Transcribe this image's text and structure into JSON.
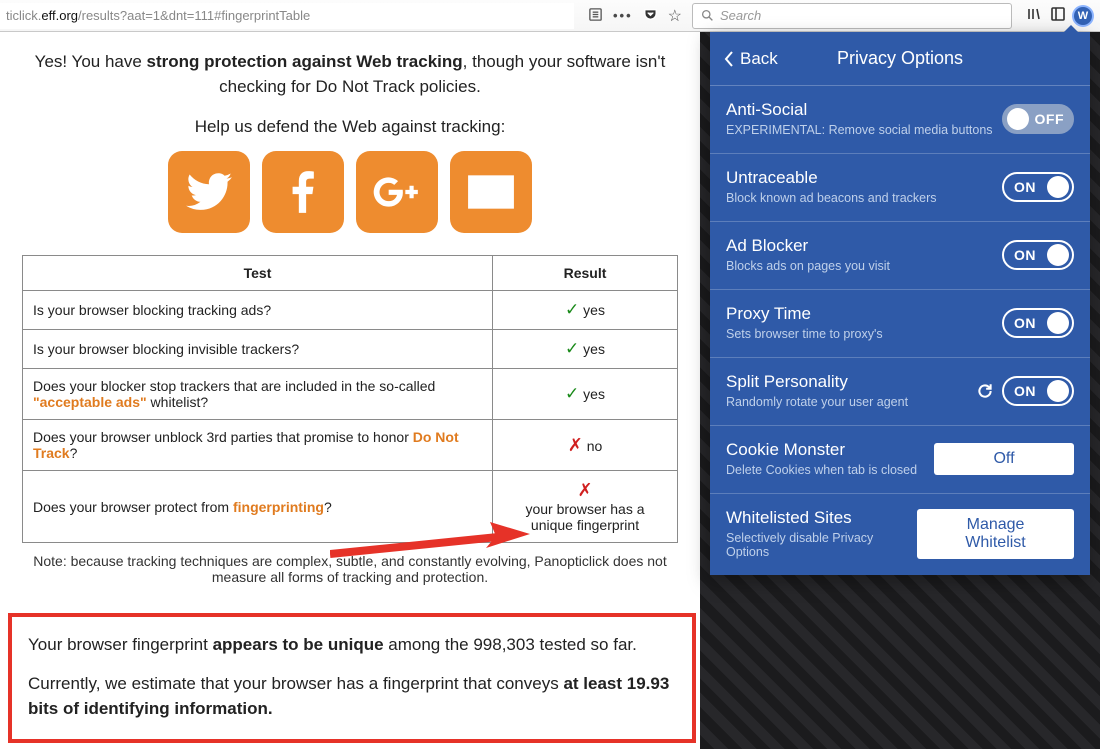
{
  "chrome": {
    "url_prefix": "ticlick.",
    "url_domain": "eff.org",
    "url_path": "/results?aat=1&dnt=111#fingerprintTable",
    "search_placeholder": "Search"
  },
  "content": {
    "headline_pre": "Yes! You have ",
    "headline_bold": "strong protection against Web tracking",
    "headline_post": ", though your software isn't checking for Do Not Track policies.",
    "help_line": "Help us defend the Web against tracking:",
    "table": {
      "head_test": "Test",
      "head_result": "Result",
      "rows": [
        {
          "test_a": "Is your browser blocking tracking ads?",
          "test_link": "",
          "test_b": "",
          "result_mark": "✓",
          "result_text": " yes",
          "pass": true
        },
        {
          "test_a": "Is your browser blocking invisible trackers?",
          "test_link": "",
          "test_b": "",
          "result_mark": "✓",
          "result_text": " yes",
          "pass": true
        },
        {
          "test_a": "Does your blocker stop trackers that are included in the so-called ",
          "test_link": "\"acceptable ads\"",
          "test_b": " whitelist?",
          "result_mark": "✓",
          "result_text": " yes",
          "pass": true
        },
        {
          "test_a": "Does your browser unblock 3rd parties that promise to honor ",
          "test_link": "Do Not Track",
          "test_b": "?",
          "result_mark": "✗",
          "result_text": " no",
          "pass": false
        },
        {
          "test_a": "Does your browser protect from ",
          "test_link": "fingerprinting",
          "test_b": "?",
          "result_mark": "✗",
          "result_text": "\nyour browser has a unique fingerprint",
          "pass": false
        }
      ]
    },
    "note": "Note: because tracking techniques are complex, subtle, and constantly evolving, Panopticlick does not measure all forms of tracking and protection.",
    "callout": {
      "p1_a": "Your browser fingerprint ",
      "p1_b": "appears to be unique",
      "p1_c": " among the 998,303 tested so far.",
      "p2_a": "Currently, we estimate that your browser has a fingerprint that conveys ",
      "p2_b": "at least 19.93 bits of identifying information."
    }
  },
  "panel": {
    "back": "Back",
    "title": "Privacy Options",
    "rows": [
      {
        "title": "Anti-Social",
        "desc": "EXPERIMENTAL: Remove social media buttons",
        "control": "toggle",
        "state": "OFF",
        "refresh": false
      },
      {
        "title": "Untraceable",
        "desc": "Block known ad beacons and trackers",
        "control": "toggle",
        "state": "ON",
        "refresh": false
      },
      {
        "title": "Ad Blocker",
        "desc": "Blocks ads on pages you visit",
        "control": "toggle",
        "state": "ON",
        "refresh": false
      },
      {
        "title": "Proxy Time",
        "desc": "Sets browser time to proxy's",
        "control": "toggle",
        "state": "ON",
        "refresh": false
      },
      {
        "title": "Split Personality",
        "desc": "Randomly rotate your user agent",
        "control": "toggle",
        "state": "ON",
        "refresh": true
      },
      {
        "title": "Cookie Monster",
        "desc": "Delete Cookies when tab is closed",
        "control": "button",
        "label": "Off"
      },
      {
        "title": "Whitelisted Sites",
        "desc": "Selectively disable Privacy Options",
        "control": "button",
        "label": "Manage Whitelist"
      }
    ]
  }
}
